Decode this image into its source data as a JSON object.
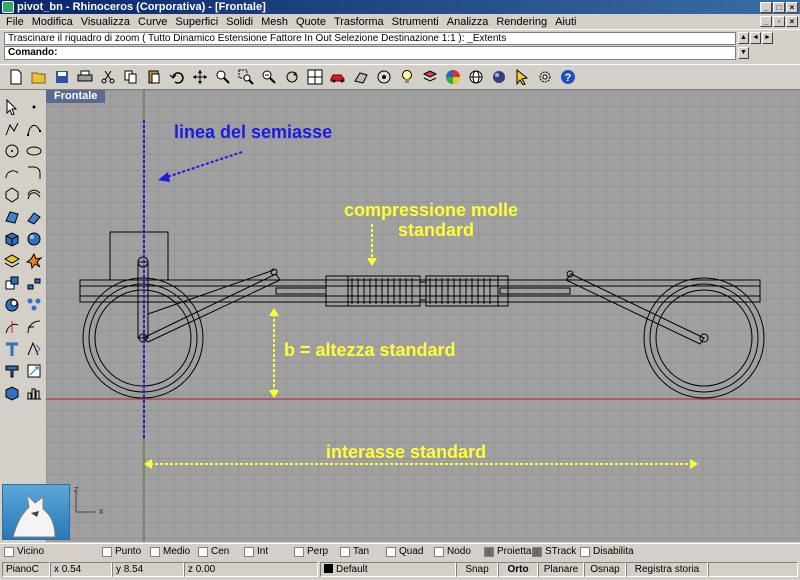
{
  "window": {
    "title": "pivot_bn - Rhinoceros (Corporativa) - [Frontale]"
  },
  "menu": [
    "File",
    "Modifica",
    "Visualizza",
    "Curve",
    "Superfici",
    "Solidi",
    "Mesh",
    "Quote",
    "Trasforma",
    "Strumenti",
    "Analizza",
    "Rendering",
    "Aiuti"
  ],
  "command": {
    "history": "Trascinare il riquadro di zoom ( Tutto  Dinamico  Estensione  Fattore  In  Out  Selezione  Destinazione  1:1 ): _Extents",
    "prompt": "Comando:"
  },
  "toolbar_icons": [
    "new-file-icon",
    "open-folder-icon",
    "save-icon",
    "print-icon",
    "cut-icon",
    "copy-icon",
    "paste-icon",
    "undo-icon",
    "pan-icon",
    "zoom-icon",
    "zoom-window-icon",
    "zoom-extents-icon",
    "rotate-view-icon",
    "four-viewports-icon",
    "car-icon",
    "shade-icon",
    "render-icon",
    "light-bulb-icon",
    "layer-icon",
    "color-wheel-icon",
    "globe-icon",
    "sphere-icon",
    "pointer-icon",
    "options-icon",
    "help-icon"
  ],
  "viewport": {
    "label": "Frontale",
    "annotations": {
      "semiasse": "linea del semiasse",
      "compressione_1": "compressione molle",
      "compressione_2": "standard",
      "altezza": "b = altezza standard",
      "interasse": "interasse standard"
    },
    "axis_z": "z",
    "axis_x": "x"
  },
  "osnaps": [
    {
      "label": "Vicino",
      "checked": false
    },
    {
      "label": "Punto",
      "checked": false
    },
    {
      "label": "Medio",
      "checked": false
    },
    {
      "label": "Cen",
      "checked": false
    },
    {
      "label": "Int",
      "checked": false
    },
    {
      "label": "Perp",
      "checked": false
    },
    {
      "label": "Tan",
      "checked": false
    },
    {
      "label": "Quad",
      "checked": false
    },
    {
      "label": "Nodo",
      "checked": false
    },
    {
      "label": "Proietta",
      "checked": true
    },
    {
      "label": "STrack",
      "checked": true
    },
    {
      "label": "Disabilita",
      "checked": false
    }
  ],
  "status": {
    "cplane": "PianoC",
    "x": "x 0.54",
    "y": "y 8.54",
    "z": "z 0.00",
    "layer": "Default",
    "snap": "Snap",
    "orto": "Orto",
    "planare": "Planare",
    "osnap": "Osnap",
    "history": "Registra storia"
  },
  "colors": {
    "annotation_blue": "#1a1ae6",
    "annotation_yellow": "#ffff33",
    "axis_green": "#2a8a2a",
    "axis_red": "#b02020"
  }
}
